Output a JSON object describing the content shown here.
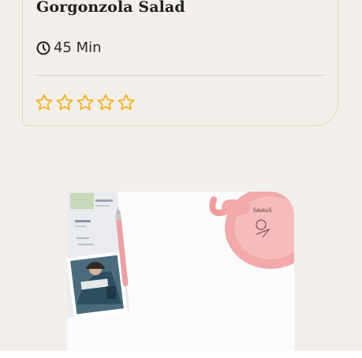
{
  "recipe": {
    "title": "Gorgonzola Salad",
    "time": "45 Min",
    "rating": 0,
    "max_rating": 5,
    "star_color": "#f2b01e"
  },
  "colors": {
    "background": "#f2efea",
    "card_border": "#e6d2c3",
    "divider": "#d7d2cc"
  },
  "image_card": {
    "icons": [
      "notebook-icon",
      "pen-icon",
      "photo-icon",
      "pink-pot-icon"
    ]
  }
}
